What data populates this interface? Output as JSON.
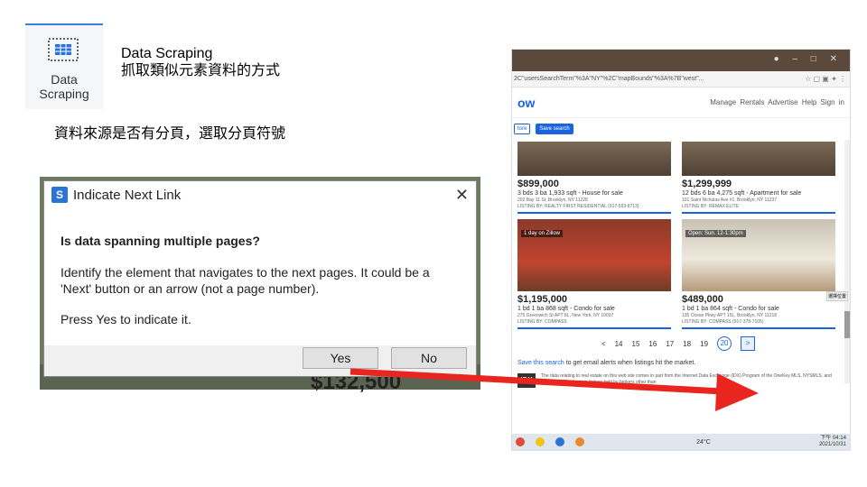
{
  "tool": {
    "label_line1": "Data",
    "label_line2": "Scraping",
    "icon": "table-scrape-icon"
  },
  "heading": {
    "line1": "Data Scraping",
    "line2": "抓取類似元素資料的方式"
  },
  "caption": "資料來源是否有分頁，選取分頁符號",
  "dialog": {
    "logo": "S",
    "title": "Indicate Next Link",
    "close": "✕",
    "question": "Is data spanning multiple pages?",
    "para1": "Identify the element that navigates to the next pages. It could be a 'Next' button or an arrow (not a page number).",
    "para2": "Press Yes to indicate it.",
    "yes_label": "Yes",
    "no_label": "No",
    "bg_number": "$132,500"
  },
  "browser": {
    "addr": "2C\"usersSearchTerm\"%3A\"NY\"%2C\"mapBounds\"%3A%7B\"west\"...",
    "logo": "ow",
    "nav_links": [
      "Manage Rentals",
      "Advertise",
      "Help",
      "Sign in"
    ],
    "chips": [
      "tore",
      "Save search"
    ],
    "listings": [
      {
        "price": "$899,000",
        "desc": "3 bds  3 ba  1,933 sqft - House for sale",
        "addr": "202 Bay 11 St, Brooklyn, NY 11228",
        "listing": "LISTING BY: REALTY FIRST RESIDENTIAL (917-593-8713)"
      },
      {
        "price": "$1,299,999",
        "desc": "12 bds  6 ba  4,275 sqft - Apartment for sale",
        "addr": "101 Saint Nicholas Ave #1, Brooklyn, NY 11237",
        "listing": "LISTING BY: REMAX ELITE"
      },
      {
        "tag": "1 day on Zillow",
        "price": "$1,195,000",
        "desc": "1 bd  1 ba  868 sqft - Condo for sale",
        "addr": "275 Greenwich St APT 8L, New York, NY 10007",
        "listing": "LISTING BY: COMPASS"
      },
      {
        "tag": "Open: Sun. 12-1:30pm",
        "price": "$489,000",
        "desc": "1 bd  1 ba  864 sqft - Condo for sale",
        "addr": "135 Ocean Pkwy APT 15L, Brooklyn, NY 11218",
        "listing": "LISTING BY: COMPASS (917-378-7105)"
      }
    ],
    "pager": [
      "<",
      "14",
      "15",
      "16",
      "17",
      "18",
      "19",
      "20",
      ">"
    ],
    "save_link": "Save this search",
    "save_rest": " to get email alerts when listings hit the market.",
    "idx_logo": "IDX",
    "idx_text": "The data relating to real estate on this web site comes in part from the Internet Data Exchange (IDX) Program of the OneKey MLS, NYSMLS, and WNYREIS. Real estate listings held by brokers other than",
    "float_btn": "選擇位置",
    "taskbar_weather": "24°C",
    "taskbar_time": "下午 04:14",
    "taskbar_date": "2021/10/31"
  },
  "colors": {
    "accent": "#1a63e0",
    "arrow": "#e8261f"
  }
}
